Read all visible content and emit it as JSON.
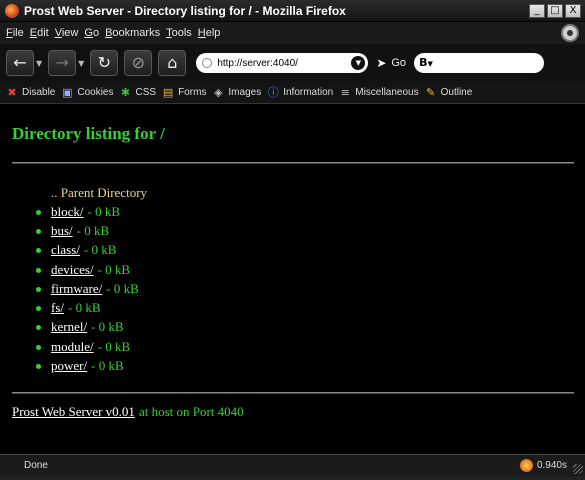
{
  "window": {
    "title": "Prost Web Server - Directory listing for / - Mozilla Firefox",
    "minimize": "_",
    "maximize": "□",
    "close": "X"
  },
  "menu": [
    {
      "u": "F",
      "rest": "ile"
    },
    {
      "u": "E",
      "rest": "dit"
    },
    {
      "u": "V",
      "rest": "iew"
    },
    {
      "u": "G",
      "rest": "o"
    },
    {
      "u": "B",
      "rest": "ookmarks"
    },
    {
      "u": "T",
      "rest": "ools"
    },
    {
      "u": "H",
      "rest": "elp"
    }
  ],
  "nav": {
    "back_icon": "arrow-left",
    "forward_icon": "arrow-right",
    "url": "http://server:4040/",
    "go_label": "Go",
    "search_engine": "B"
  },
  "devbar": [
    {
      "label": "Disable",
      "icon": "✖",
      "color": "#e04040"
    },
    {
      "label": "Cookies",
      "icon": "▣",
      "color": "#8fb0ff"
    },
    {
      "label": "CSS",
      "icon": "✱",
      "color": "#40c040"
    },
    {
      "label": "Forms",
      "icon": "▤",
      "color": "#e0b040"
    },
    {
      "label": "Images",
      "icon": "◈",
      "color": "#c0c0c0"
    },
    {
      "label": "Information",
      "icon": "ⓘ",
      "color": "#5a8fff"
    },
    {
      "label": "Miscellaneous",
      "icon": "≡",
      "color": "#c0c0c0"
    },
    {
      "label": "Outline",
      "icon": "✎",
      "color": "#e0c040"
    }
  ],
  "page": {
    "title": "Directory listing for /",
    "parent_link": ".. Parent Directory",
    "entries": [
      {
        "name": "block/",
        "size": "- 0 kB"
      },
      {
        "name": "bus/",
        "size": "- 0 kB"
      },
      {
        "name": "class/",
        "size": "- 0 kB"
      },
      {
        "name": "devices/",
        "size": "- 0 kB"
      },
      {
        "name": "firmware/",
        "size": "- 0 kB"
      },
      {
        "name": "fs/",
        "size": "- 0 kB"
      },
      {
        "name": "kernel/",
        "size": "- 0 kB"
      },
      {
        "name": "module/",
        "size": "- 0 kB"
      },
      {
        "name": "power/",
        "size": "- 0 kB"
      }
    ],
    "footer_link": "Prost Web Server v0.01",
    "footer_host": "at host on Port 4040"
  },
  "status": {
    "text": "Done",
    "time": "0.940s"
  }
}
